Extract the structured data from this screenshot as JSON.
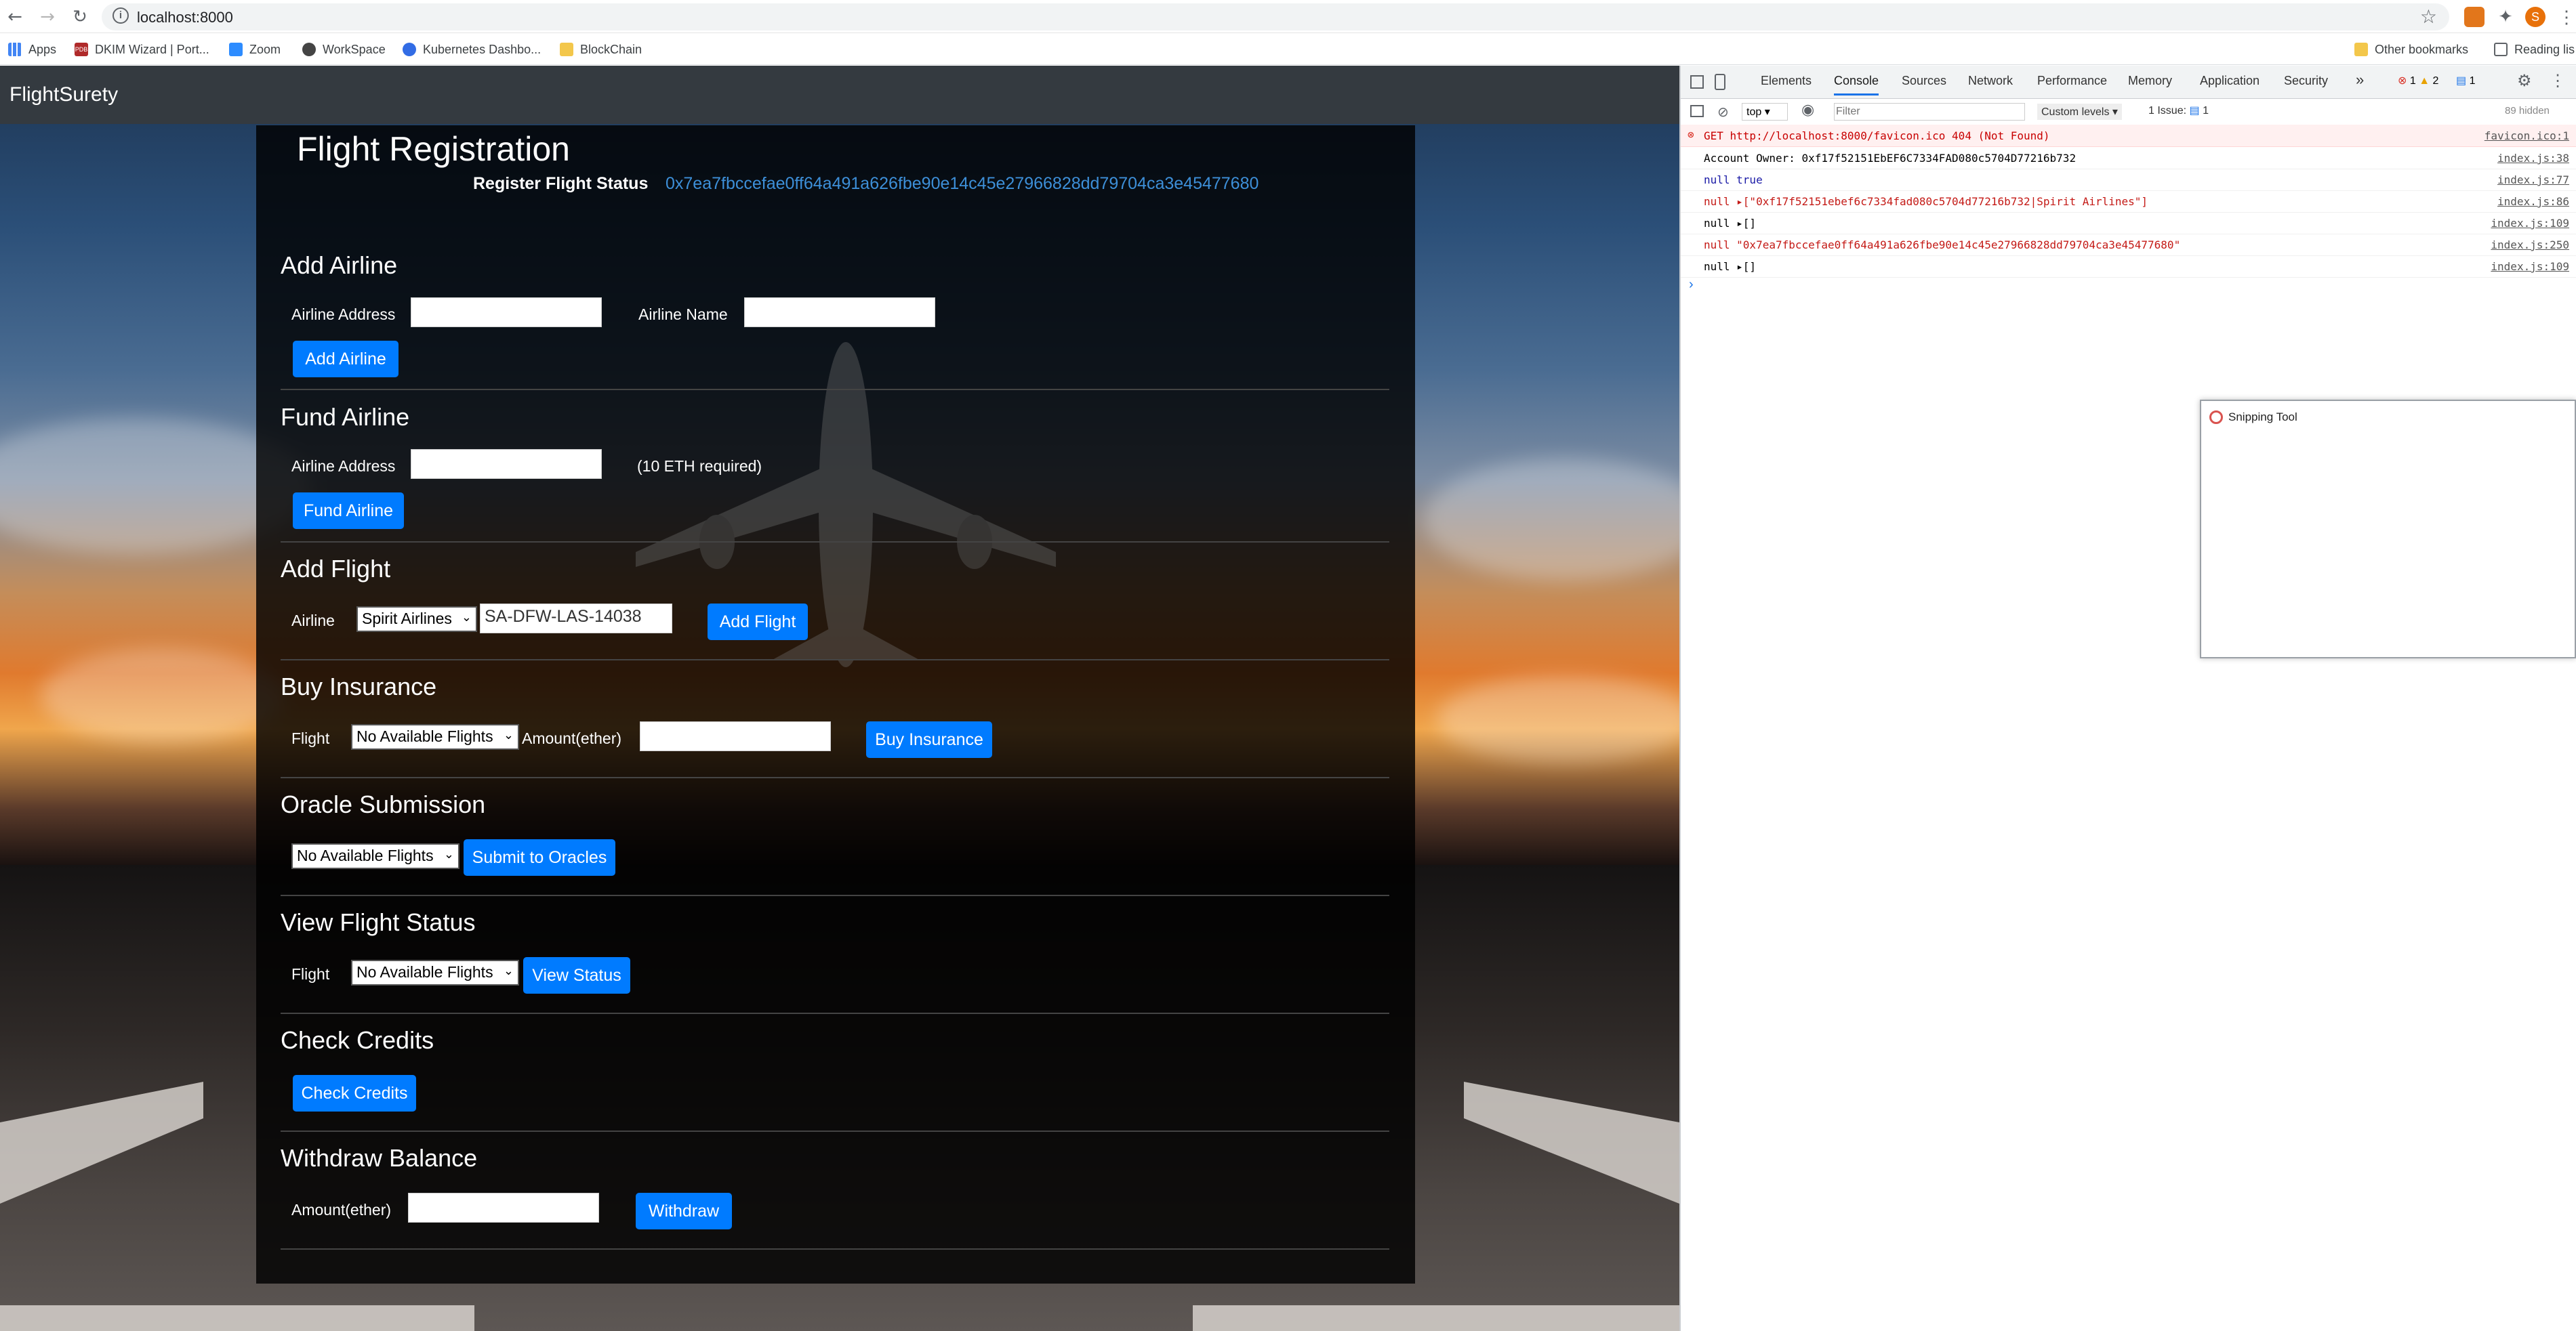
{
  "browser": {
    "url": "localhost:8000",
    "profile_initial": "S",
    "bookmarks": [
      {
        "label": "Apps"
      },
      {
        "label": "DKIM Wizard | Port...",
        "badge": "PDB"
      },
      {
        "label": "Zoom"
      },
      {
        "label": "WorkSpace"
      },
      {
        "label": "Kubernetes Dashbo..."
      },
      {
        "label": "BlockChain"
      }
    ],
    "other_bookmarks": "Other bookmarks",
    "reading_list": "Reading lis"
  },
  "app": {
    "brand": "FlightSurety",
    "title": "Flight Registration",
    "register_status_label": "Register Flight Status",
    "register_status_value": "0x7ea7fbccefae0ff64a491a626fbe90e14c45e27966828dd79704ca3e45477680",
    "add_airline": {
      "heading": "Add Airline",
      "address_label": "Airline Address",
      "name_label": "Airline Name",
      "button": "Add Airline"
    },
    "fund_airline": {
      "heading": "Fund Airline",
      "address_label": "Airline Address",
      "note": "(10 ETH required)",
      "button": "Fund Airline"
    },
    "add_flight": {
      "heading": "Add Flight",
      "airline_label": "Airline",
      "airline_selected": "Spirit Airlines",
      "flight_value": "SA-DFW-LAS-14038",
      "button": "Add Flight"
    },
    "buy_insurance": {
      "heading": "Buy Insurance",
      "flight_label": "Flight",
      "flight_selected": "No Available Flights",
      "amount_label": "Amount(ether)",
      "button": "Buy Insurance"
    },
    "oracle": {
      "heading": "Oracle Submission",
      "flight_selected": "No Available Flights",
      "button": "Submit to Oracles"
    },
    "view_status": {
      "heading": "View Flight Status",
      "flight_label": "Flight",
      "flight_selected": "No Available Flights",
      "button": "View Status"
    },
    "check_credits": {
      "heading": "Check Credits",
      "button": "Check Credits"
    },
    "withdraw": {
      "heading": "Withdraw Balance",
      "amount_label": "Amount(ether)",
      "button": "Withdraw"
    }
  },
  "devtools": {
    "tabs": [
      "Elements",
      "Console",
      "Sources",
      "Network",
      "Performance",
      "Memory",
      "Application",
      "Security"
    ],
    "active_tab": "Console",
    "more_tabs": "»",
    "badges": {
      "errors": "1",
      "warnings": "2",
      "messages": "1"
    },
    "context": "top",
    "filter_placeholder": "Filter",
    "levels": "Custom levels",
    "issues": "1 Issue:",
    "issues_count": "1",
    "hidden": "89 hidden",
    "console": [
      {
        "type": "error",
        "message": "GET http://localhost:8000/favicon.ico 404 (Not Found)",
        "source": "favicon.ico:1"
      },
      {
        "type": "log",
        "message": "Account Owner: 0xf17f52151EbEF6C7334FAD080c5704D77216b732",
        "source": "index.js:38"
      },
      {
        "type": "log",
        "message": "null true",
        "source": "index.js:77"
      },
      {
        "type": "log",
        "message": "null ▸[\"0xf17f52151ebef6c7334fad080c5704d77216b732|Spirit Airlines\"]",
        "source": "index.js:86"
      },
      {
        "type": "log",
        "message": "null ▸[]",
        "source": "index.js:109"
      },
      {
        "type": "log",
        "message": "null \"0x7ea7fbccefae0ff64a491a626fbe90e14c45e27966828dd79704ca3e45477680\"",
        "source": "index.js:250"
      },
      {
        "type": "log",
        "message": "null ▸[]",
        "source": "index.js:109"
      }
    ],
    "prompt": "›"
  },
  "snipping_tool": {
    "title": "Snipping Tool"
  }
}
